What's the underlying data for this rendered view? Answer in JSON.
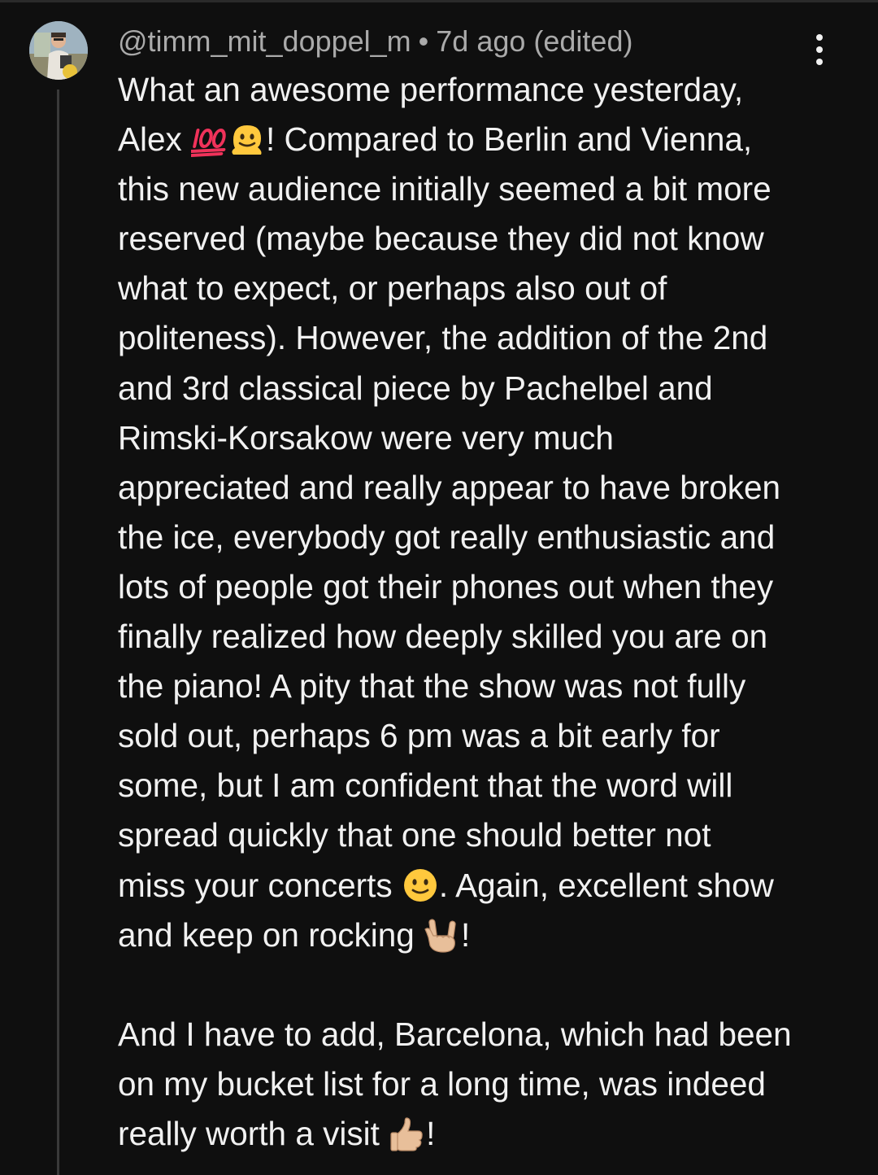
{
  "comment": {
    "author": "@timm_mit_doppel_m",
    "separator": "•",
    "timestamp": "7d ago (edited)",
    "body": {
      "l1": "What an awesome performance yesterday,",
      "l2a": "Alex ",
      "l2b": "! Compared to Berlin and Vienna,",
      "l3": "this new audience initially seemed a bit more",
      "l4": "reserved (maybe because they did not know",
      "l5": "what to expect, or perhaps also out of",
      "l6": "politeness). However, the addition of the 2nd",
      "l7": "and 3rd classical piece by Pachelbel and",
      "l8": "Rimski-Korsakow were very much",
      "l9": "appreciated and really appear to have broken",
      "l10": "the ice, everybody got really enthusiastic and",
      "l11": "lots of people got their phones out when they",
      "l12": "finally realized how deeply skilled you are on",
      "l13": "the piano! A pity that the show was not fully",
      "l14": "sold out, perhaps 6 pm was a bit early for",
      "l15": "some, but I am confident that the word will",
      "l16": "spread quickly that one should better not",
      "l17a": "miss your concerts ",
      "l17b": ". Again, excellent show",
      "l18a": "and keep on rocking ",
      "l18b": "!",
      "l19": "And I have to add, Barcelona, which had been",
      "l20": "on my bucket list for a long time, was indeed",
      "l21a": "really worth a visit ",
      "l21b": "!"
    },
    "emojis": [
      "hundred-points",
      "melting-face",
      "slightly-smiling-face",
      "love-you-gesture",
      "thumbs-up"
    ]
  },
  "colors": {
    "background": "#0f0f0f",
    "text": "#f1f1f1",
    "secondary_text": "#aaaaaa",
    "thread_line": "#3a3a3a"
  }
}
